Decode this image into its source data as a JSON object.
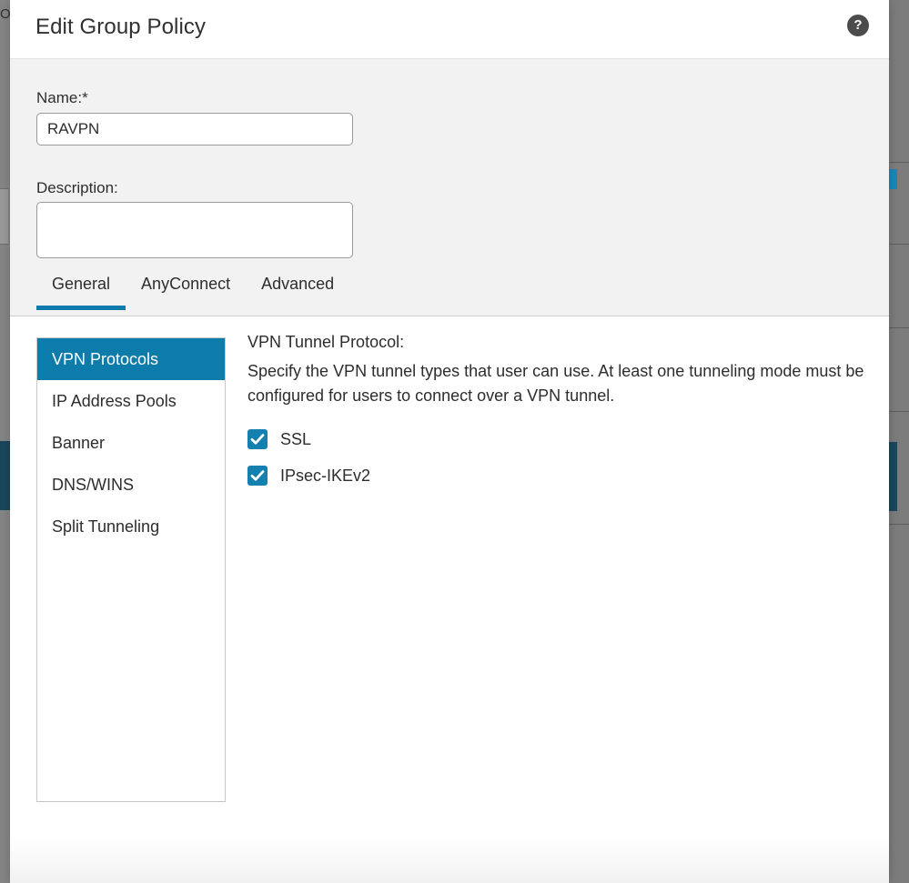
{
  "backdrop": {
    "partial_label": "Ov"
  },
  "dialog": {
    "title": "Edit Group Policy",
    "help_icon": "help-question-icon",
    "help_label": "?"
  },
  "form": {
    "name": {
      "label": "Name:*",
      "value": "RAVPN",
      "placeholder": ""
    },
    "description": {
      "label": "Description:",
      "value": "",
      "placeholder": ""
    }
  },
  "tabs": [
    {
      "label": "General",
      "active": true
    },
    {
      "label": "AnyConnect",
      "active": false
    },
    {
      "label": "Advanced",
      "active": false
    }
  ],
  "nav": {
    "items": [
      {
        "label": "VPN Protocols",
        "active": true
      },
      {
        "label": "IP Address Pools",
        "active": false
      },
      {
        "label": "Banner",
        "active": false
      },
      {
        "label": "DNS/WINS",
        "active": false
      },
      {
        "label": "Split Tunneling",
        "active": false
      }
    ]
  },
  "panel": {
    "title": "VPN Tunnel Protocol:",
    "description": "Specify the VPN tunnel types that user can use. At least one tunneling mode must be configured for users to connect over a VPN tunnel.",
    "checkboxes": [
      {
        "label": "SSL",
        "checked": true
      },
      {
        "label": "IPsec-IKEv2",
        "checked": true
      }
    ]
  },
  "colors": {
    "accent_blue": "#0e7cab",
    "checkbox_blue": "#1580b0",
    "tab_underline": "#0d7bab",
    "backdrop_navy": "#1b475c",
    "text": "#2d2d2d",
    "form_bg": "#f2f2f2"
  }
}
